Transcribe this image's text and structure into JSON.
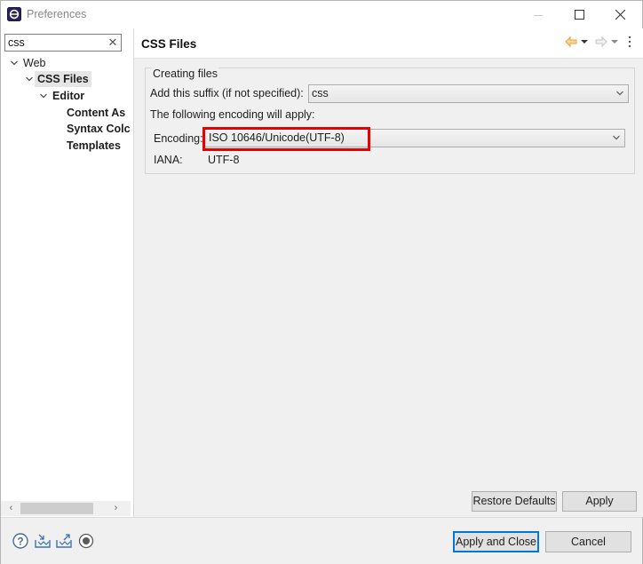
{
  "window": {
    "title": "Preferences"
  },
  "filter": {
    "value": "css"
  },
  "tree": {
    "items": [
      {
        "label": "Web"
      },
      {
        "label": "CSS Files"
      },
      {
        "label": "Editor"
      },
      {
        "label": "Content As"
      },
      {
        "label": "Syntax Colc"
      },
      {
        "label": "Templates"
      }
    ]
  },
  "page": {
    "title": "CSS Files",
    "group_title": "Creating files",
    "suffix_label": "Add this suffix (if not specified):",
    "suffix_value": "css",
    "encoding_intro": "The following encoding will apply:",
    "encoding_label": "Encoding:",
    "encoding_value": "ISO 10646/Unicode(UTF-8)",
    "iana_label": "IANA:",
    "iana_value": "UTF-8"
  },
  "buttons": {
    "restore_defaults": "Restore Defaults",
    "apply": "Apply",
    "apply_and_close": "Apply and Close",
    "cancel": "Cancel"
  },
  "icons": {
    "help": "help-icon",
    "import": "import-icon",
    "export": "export-icon",
    "record": "record-icon",
    "back": "back-arrow-icon",
    "forward": "forward-arrow-icon",
    "menu": "view-menu-icon"
  },
  "colors": {
    "highlight": "#e60000",
    "default_button_border": "#0078d7",
    "back_arrow": "#e8a33d"
  }
}
